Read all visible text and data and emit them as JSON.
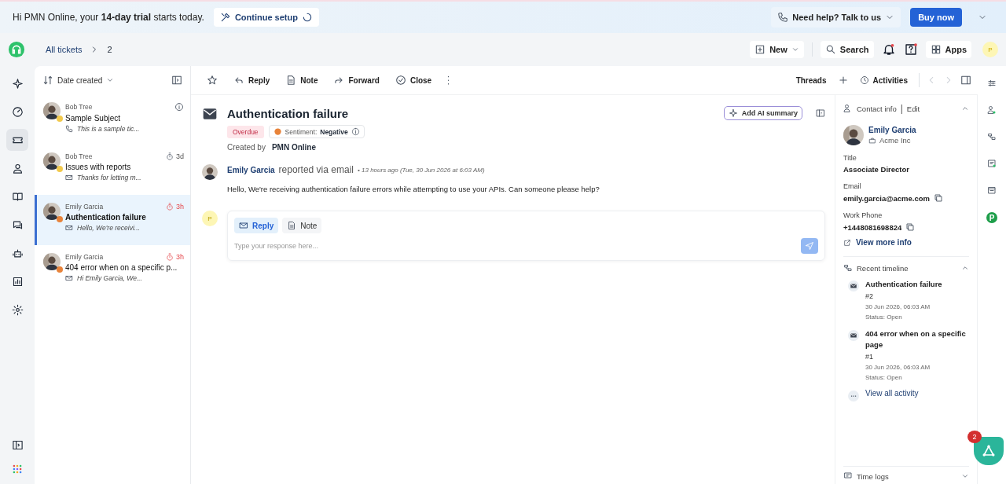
{
  "banner": {
    "greeting": "Hi PMN Online, your **14-day trial** starts today.",
    "setup": "Continue setup",
    "help": "Need help? Talk to us",
    "buy": "Buy now"
  },
  "header": {
    "breadcrumb": "All tickets",
    "current": "2",
    "new": "New",
    "search": "Search",
    "apps": "Apps",
    "avatar": "P"
  },
  "rail": [
    {
      "kind": "sparkle",
      "selected": false
    },
    {
      "kind": "gauge",
      "selected": false
    },
    {
      "kind": "ticket",
      "selected": true
    },
    {
      "kind": "person",
      "selected": false
    },
    {
      "kind": "book",
      "selected": false
    },
    {
      "kind": "chat",
      "selected": false
    },
    {
      "kind": "robot",
      "selected": false
    },
    {
      "kind": "chart",
      "selected": false
    },
    {
      "kind": "gear",
      "selected": false
    }
  ],
  "list": {
    "sort": "Date created",
    "tickets": [
      {
        "requester": "Bob Tree",
        "subject": "Sample Subject",
        "preview": "This is a sample tic...",
        "kind": "phone",
        "color": "#f2c94c",
        "sla": {
          "kind": "info"
        },
        "selected": false
      },
      {
        "requester": "Bob Tree",
        "subject": "Issues with reports",
        "preview": "Thanks for letting m...",
        "kind": "email",
        "color": "#f2c94c",
        "sla": {
          "kind": "timer",
          "text": "3d",
          "overdue": false
        },
        "selected": false
      },
      {
        "requester": "Emily Garcia",
        "subject": "Authentication failure",
        "preview": "Hello, We're receivi...",
        "kind": "email",
        "color": "#e8833a",
        "sla": {
          "kind": "timer",
          "text": "3h",
          "overdue": true
        },
        "selected": true
      },
      {
        "requester": "Emily Garcia",
        "subject": "404 error when on a specific p...",
        "preview": "Hi Emily Garcia, We...",
        "kind": "email",
        "color": "#e8833a",
        "sla": {
          "kind": "timer",
          "text": "3h",
          "overdue": true
        },
        "selected": false
      }
    ]
  },
  "toolbar": {
    "actions": [
      {
        "kind": "reply",
        "label": "Reply"
      },
      {
        "kind": "note",
        "label": "Note"
      },
      {
        "kind": "forward",
        "label": "Forward"
      },
      {
        "kind": "close",
        "label": "Close"
      }
    ],
    "threads": "Threads",
    "activities": "Activities"
  },
  "ticket": {
    "title": "Authentication failure",
    "status": "Overdue",
    "sentiment_label": "Sentiment:",
    "sentiment": "Negative",
    "created_by_label": "Created by",
    "created_by": "PMN Online",
    "ai_button": "Add AI summary",
    "message": {
      "author": "Emily Garcia",
      "via": "reported via email",
      "time": "• 13 hours ago (Tue, 30 Jun 2026 at 6:03 AM)",
      "body": "Hello, We're receiving authentication failure errors while attempting to use your APIs. Can someone please help?"
    },
    "composer": {
      "avatar": "P",
      "tabs": [
        {
          "kind": "email",
          "label": "Reply",
          "selected": true
        },
        {
          "kind": "note",
          "label": "Note",
          "selected": false
        }
      ],
      "placeholder": "Type your response here..."
    }
  },
  "contact": {
    "heading": "Contact info",
    "separator": "|",
    "edit": "Edit",
    "name": "Emily Garcia",
    "company": "Acme Inc",
    "fields": [
      {
        "label": "Title",
        "value": "Associate Director",
        "copyable": false
      },
      {
        "label": "Email",
        "value": "emily.garcia@acme.com",
        "copyable": true
      },
      {
        "label": "Work Phone",
        "value": "+1448081698824",
        "copyable": true
      }
    ],
    "more": "View more info"
  },
  "timeline": {
    "heading": "Recent timeline",
    "items": [
      {
        "title": "Authentication failure",
        "number": "#2",
        "date": "30 Jun 2026, 06:03 AM",
        "status": "Status: Open"
      },
      {
        "title": "404 error when on a specific page",
        "number": "#1",
        "date": "30 Jun 2026, 06:03 AM",
        "status": "Status: Open"
      }
    ],
    "all": "View all activity"
  },
  "time_logs": "Time logs",
  "fab_count": "2",
  "rail_badge": "P"
}
